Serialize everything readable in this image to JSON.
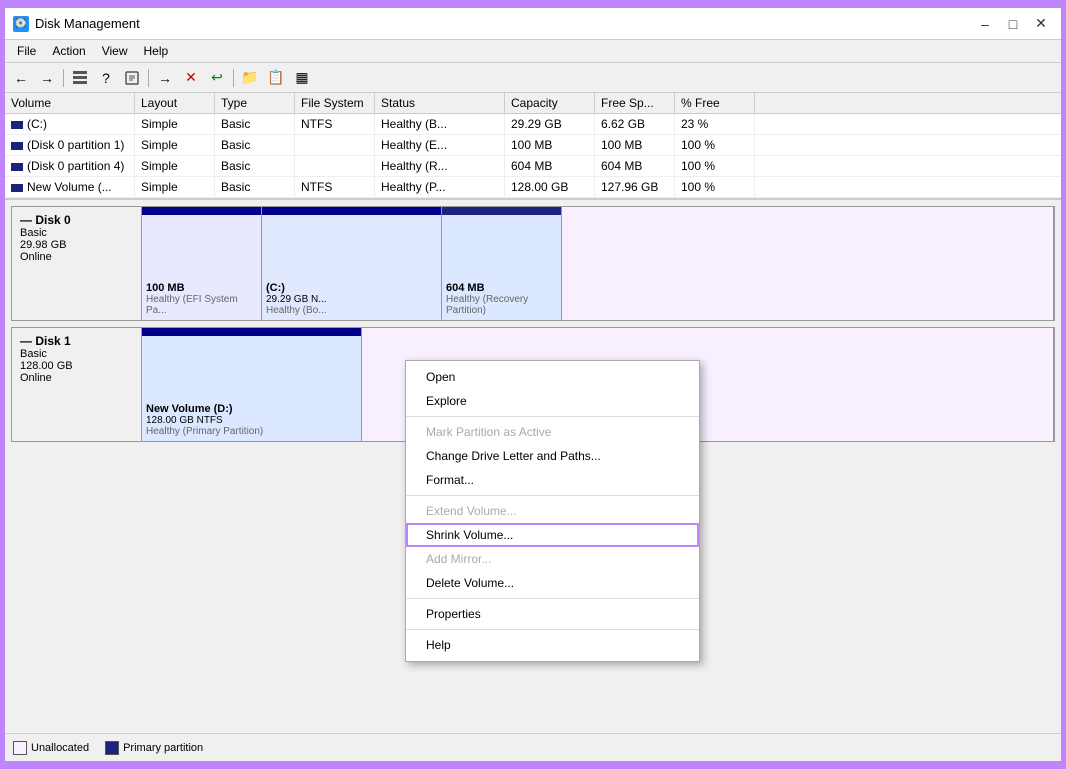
{
  "window": {
    "title": "Disk Management",
    "icon": "💽"
  },
  "menu": {
    "items": [
      "File",
      "Action",
      "View",
      "Help"
    ]
  },
  "toolbar": {
    "buttons": [
      "←",
      "→",
      "⊞",
      "?",
      "≡",
      "→",
      "✕",
      "↩",
      "📁",
      "📋",
      "▦"
    ]
  },
  "table": {
    "columns": [
      "Volume",
      "Layout",
      "Type",
      "File System",
      "Status",
      "Capacity",
      "Free Sp...",
      "% Free"
    ],
    "rows": [
      {
        "volume": "(C:)",
        "layout": "Simple",
        "type": "Basic",
        "fs": "NTFS",
        "status": "Healthy (B...",
        "capacity": "29.29 GB",
        "free": "6.62 GB",
        "pct": "23 %"
      },
      {
        "volume": "(Disk 0 partition 1)",
        "layout": "Simple",
        "type": "Basic",
        "fs": "",
        "status": "Healthy (E...",
        "capacity": "100 MB",
        "free": "100 MB",
        "pct": "100 %"
      },
      {
        "volume": "(Disk 0 partition 4)",
        "layout": "Simple",
        "type": "Basic",
        "fs": "",
        "status": "Healthy (R...",
        "capacity": "604 MB",
        "free": "604 MB",
        "pct": "100 %"
      },
      {
        "volume": "New Volume (...",
        "layout": "Simple",
        "type": "Basic",
        "fs": "NTFS",
        "status": "Healthy (P...",
        "capacity": "128.00 GB",
        "free": "127.96 GB",
        "pct": "100 %"
      }
    ]
  },
  "disks": [
    {
      "name": "Disk 0",
      "type": "Basic",
      "size": "29.98 GB",
      "status": "Online",
      "partitions": [
        {
          "label": "100 MB",
          "sub": "Healthy (EFI System Pa...",
          "type": "efi"
        },
        {
          "label": "(C:)",
          "sub": "29.29 GB N...",
          "sub2": "Healthy (Bo...",
          "type": "c"
        },
        {
          "label": "604 MB",
          "sub": "Healthy (Recovery Partition)",
          "type": "recovery"
        },
        {
          "label": "",
          "sub": "",
          "type": "unalloc"
        }
      ]
    },
    {
      "name": "Disk 1",
      "type": "Basic",
      "size": "128.00 GB",
      "status": "Online",
      "partitions": [
        {
          "label": "New Volume (D:)",
          "sub": "128.00 GB NTFS",
          "sub2": "Healthy (Primary Partition)",
          "type": "d"
        },
        {
          "label": "",
          "sub": "",
          "type": "unalloc2"
        }
      ]
    }
  ],
  "context_menu": {
    "items": [
      {
        "label": "Open",
        "disabled": false,
        "id": "ctx-open"
      },
      {
        "label": "Explore",
        "disabled": false,
        "id": "ctx-explore"
      },
      {
        "separator_after": true
      },
      {
        "label": "Mark Partition as Active",
        "disabled": true,
        "id": "ctx-mark-active"
      },
      {
        "label": "Change Drive Letter and Paths...",
        "disabled": false,
        "id": "ctx-change-letter"
      },
      {
        "label": "Format...",
        "disabled": false,
        "id": "ctx-format"
      },
      {
        "separator_after": true
      },
      {
        "label": "Extend Volume...",
        "disabled": true,
        "id": "ctx-extend"
      },
      {
        "label": "Shrink Volume...",
        "disabled": false,
        "highlighted": true,
        "id": "ctx-shrink"
      },
      {
        "label": "Add Mirror...",
        "disabled": true,
        "id": "ctx-add-mirror"
      },
      {
        "label": "Delete Volume...",
        "disabled": false,
        "id": "ctx-delete"
      },
      {
        "separator_after": true
      },
      {
        "label": "Properties",
        "disabled": false,
        "id": "ctx-properties"
      },
      {
        "separator_after": true
      },
      {
        "label": "Help",
        "disabled": false,
        "id": "ctx-help"
      }
    ]
  },
  "status_bar": {
    "legend": [
      {
        "type": "unalloc",
        "label": "Unallocated"
      },
      {
        "type": "primary",
        "label": "Primary partition"
      }
    ]
  }
}
